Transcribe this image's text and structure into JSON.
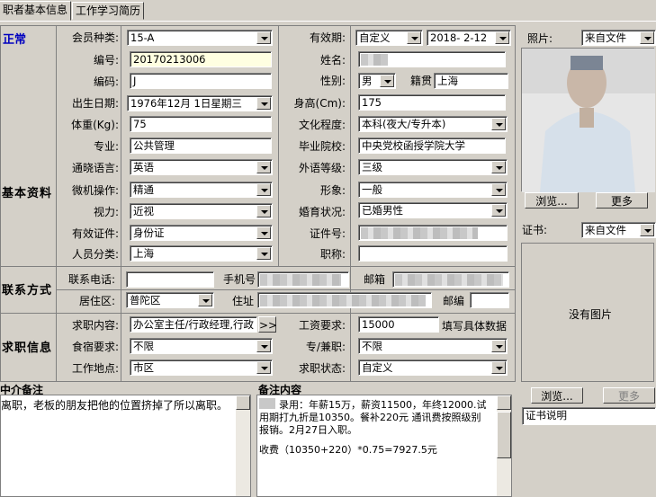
{
  "tabs": [
    "职者基本信息",
    "工作学习简历"
  ],
  "status": "正常",
  "sections": {
    "basic": "基本资料",
    "contact": "联系方式",
    "job": "求职信息"
  },
  "fields": {
    "member_type": {
      "label": "会员种类:",
      "value": "15-A"
    },
    "validity": {
      "label": "有效期:",
      "value": "自定义",
      "date": "2018- 2-12"
    },
    "number": {
      "label": "编号:",
      "value": "20170213006"
    },
    "name": {
      "label": "姓名:",
      "value": ""
    },
    "code": {
      "label": "编码:",
      "value": "J"
    },
    "gender": {
      "label": "性别:",
      "value": "男"
    },
    "native": {
      "label": "籍贯",
      "value": "上海"
    },
    "birth": {
      "label": "出生日期:",
      "value": "1976年12月 1日星期三"
    },
    "height": {
      "label": "身高(Cm):",
      "value": "175"
    },
    "weight": {
      "label": "体重(Kg):",
      "value": "75"
    },
    "education": {
      "label": "文化程度:",
      "value": "本科(夜大/专升本)"
    },
    "major": {
      "label": "专业:",
      "value": "公共管理"
    },
    "school": {
      "label": "毕业院校:",
      "value": "中央党校函授学院大学"
    },
    "language": {
      "label": "通晓语言:",
      "value": "英语"
    },
    "lang_level": {
      "label": "外语等级:",
      "value": "三级"
    },
    "computer": {
      "label": "微机操作:",
      "value": "精通"
    },
    "appearance": {
      "label": "形象:",
      "value": "一般"
    },
    "vision": {
      "label": "视力:",
      "value": "近视"
    },
    "marital": {
      "label": "婚育状况:",
      "value": "已婚男性"
    },
    "id_type": {
      "label": "有效证件:",
      "value": "身份证"
    },
    "id_no": {
      "label": "证件号:",
      "value": ""
    },
    "category": {
      "label": "人员分类:",
      "value": "上海"
    },
    "title": {
      "label": "职称:",
      "value": ""
    },
    "phone": {
      "label": "联系电话:",
      "value": ""
    },
    "mobile": {
      "label": "手机号",
      "value": ""
    },
    "email": {
      "label": "邮箱",
      "value": ""
    },
    "district": {
      "label": "居住区:",
      "value": "普陀区"
    },
    "address": {
      "label": "住址",
      "value": ""
    },
    "postcode": {
      "label": "邮编",
      "value": ""
    },
    "job_content": {
      "label": "求职内容:",
      "value": "办公室主任/行政经理,行政"
    },
    "salary": {
      "label": "工资要求:",
      "value": "15000",
      "hint": "填写具体数据"
    },
    "lodging": {
      "label": "食宿要求:",
      "value": "不限"
    },
    "fulltime": {
      "label": "专/兼职:",
      "value": "不限"
    },
    "location": {
      "label": "工作地点:",
      "value": "市区"
    },
    "job_status": {
      "label": "求职状态:",
      "value": "自定义"
    }
  },
  "more_btn": ">>",
  "agent_note": {
    "label": "中介备注",
    "text": "离职，老板的朋友把他的位置挤掉了所以离职。"
  },
  "remark": {
    "label": "备注内容",
    "line1": "录用：年薪15万，薪资11500，年终12000.试",
    "line2": "用期打九折是10350。餐补220元 通讯费按照级别",
    "line3": "报销。2月27日入职。",
    "line4": "收费（10350+220）*0.75=7927.5元"
  },
  "photo": {
    "label": "照片:",
    "source": "来自文件",
    "browse": "浏览...",
    "more": "更多"
  },
  "cert": {
    "label": "证书:",
    "source": "来自文件",
    "empty": "没有图片",
    "browse": "浏览...",
    "more": "更多",
    "desc": "证书说明"
  }
}
